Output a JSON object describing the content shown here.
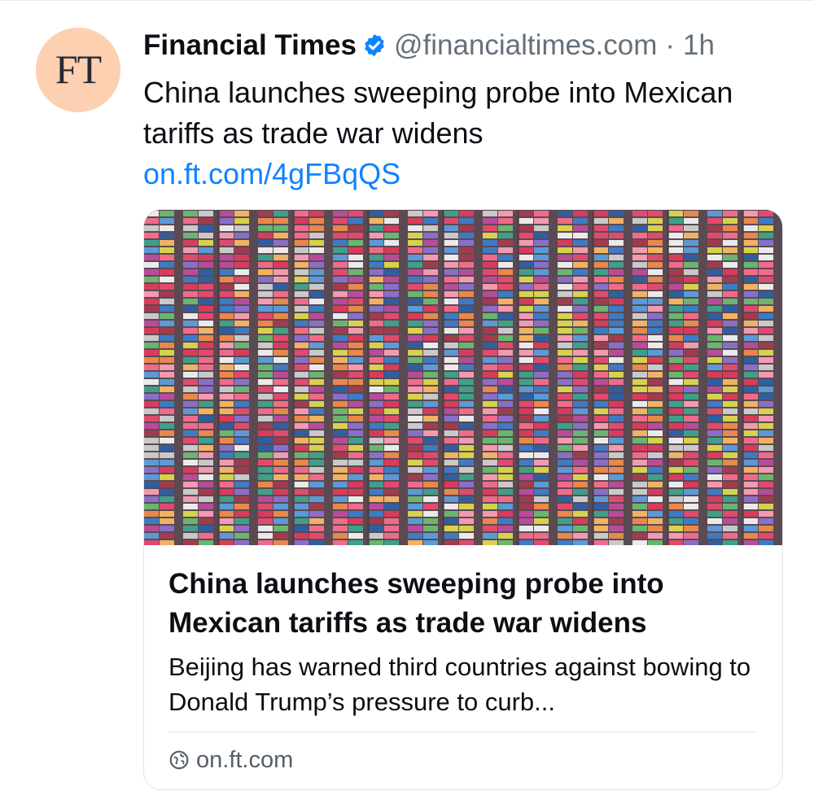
{
  "post": {
    "avatar_text": "FT",
    "author_name": "Financial Times",
    "handle": "@financialtimes.com",
    "separator": "·",
    "time": "1h",
    "text": "China launches sweeping probe into Mexican tariffs as trade war widens",
    "link_text": "on.ft.com/4gFBqQS"
  },
  "card": {
    "image_alt": "Aerial view of a container port",
    "title": "China launches sweeping probe into Mexican tariffs as trade war widens",
    "description": "Beijing has warned third countries against bowing to Donald Trump’s pressure to curb...",
    "domain": "on.ft.com"
  },
  "colors": {
    "link": "#1083fe",
    "avatar_bg": "#fcd0b1",
    "verified_badge": "#1083fe",
    "secondary_text": "#66707a"
  },
  "icons": {
    "verified": "verified-check-icon",
    "domain": "globe-icon"
  }
}
